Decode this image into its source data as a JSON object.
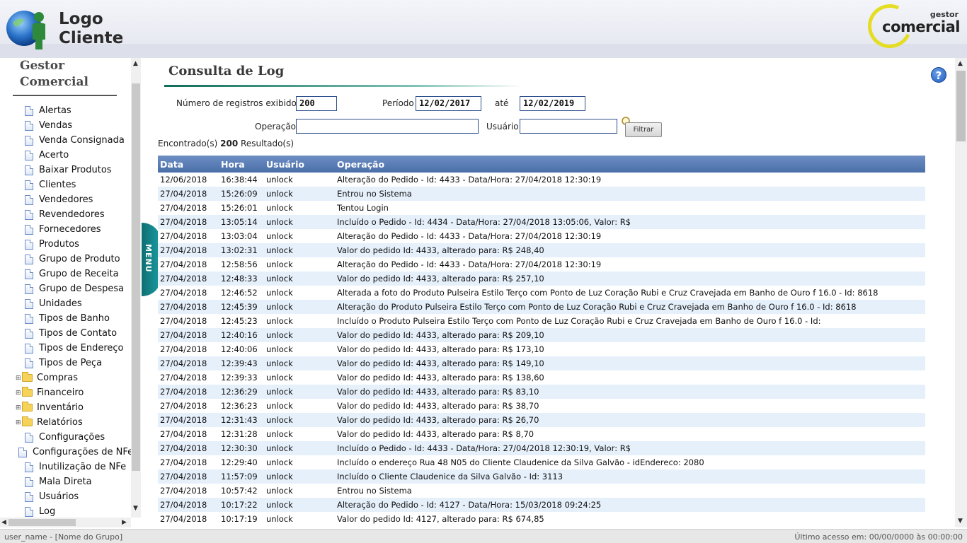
{
  "header": {
    "logo_line1": "Logo",
    "logo_line2": "Cliente",
    "brand_small": "gestor",
    "brand_big": "comercial"
  },
  "sidebar": {
    "title_line1": "Gestor",
    "title_line2": "Comercial",
    "menu_tab": "MENU",
    "items": [
      {
        "label": "Alertas",
        "type": "doc"
      },
      {
        "label": "Vendas",
        "type": "doc"
      },
      {
        "label": "Venda Consignada",
        "type": "doc"
      },
      {
        "label": "Acerto",
        "type": "doc"
      },
      {
        "label": "Baixar Produtos",
        "type": "doc"
      },
      {
        "label": "Clientes",
        "type": "doc"
      },
      {
        "label": "Vendedores",
        "type": "doc"
      },
      {
        "label": "Revendedores",
        "type": "doc"
      },
      {
        "label": "Fornecedores",
        "type": "doc"
      },
      {
        "label": "Produtos",
        "type": "doc"
      },
      {
        "label": "Grupo de Produto",
        "type": "doc"
      },
      {
        "label": "Grupo de Receita",
        "type": "doc"
      },
      {
        "label": "Grupo de Despesa",
        "type": "doc"
      },
      {
        "label": "Unidades",
        "type": "doc"
      },
      {
        "label": "Tipos de Banho",
        "type": "doc"
      },
      {
        "label": "Tipos de Contato",
        "type": "doc"
      },
      {
        "label": "Tipos de Endereço",
        "type": "doc"
      },
      {
        "label": "Tipos de Peça",
        "type": "doc"
      },
      {
        "label": "Compras",
        "type": "folder"
      },
      {
        "label": "Financeiro",
        "type": "folder"
      },
      {
        "label": "Inventário",
        "type": "folder"
      },
      {
        "label": "Relatórios",
        "type": "folder"
      },
      {
        "label": "Configurações",
        "type": "doc"
      },
      {
        "label": "Configurações de NFe",
        "type": "doc"
      },
      {
        "label": "Inutilização de NFe",
        "type": "doc"
      },
      {
        "label": "Mala Direta",
        "type": "doc"
      },
      {
        "label": "Usuários",
        "type": "doc"
      },
      {
        "label": "Log",
        "type": "doc"
      }
    ]
  },
  "main": {
    "title": "Consulta de Log",
    "filters": {
      "num_records_label": "Número de registros exibidos",
      "num_records_value": "200",
      "period_label": "Período",
      "period_start": "12/02/2017",
      "until_label": "até",
      "period_end": "12/02/2019",
      "operation_label": "Operação",
      "operation_value": "",
      "user_label": "Usuário",
      "user_value": "",
      "filter_button": "Filtrar"
    },
    "found_prefix": "Encontrado(s)",
    "found_count": "200",
    "found_suffix": "Resultado(s)",
    "table": {
      "columns": [
        "Data",
        "Hora",
        "Usuário",
        "Operação"
      ],
      "rows": [
        [
          "12/06/2018",
          "16:38:44",
          "unlock",
          "Alteração do Pedido - Id: 4433 - Data/Hora: 27/04/2018 12:30:19"
        ],
        [
          "27/04/2018",
          "15:26:09",
          "unlock",
          "Entrou no Sistema"
        ],
        [
          "27/04/2018",
          "15:26:01",
          "unlock",
          "Tentou Login"
        ],
        [
          "27/04/2018",
          "13:05:14",
          "unlock",
          "Incluído o Pedido - Id: 4434 - Data/Hora: 27/04/2018 13:05:06, Valor: R$"
        ],
        [
          "27/04/2018",
          "13:03:04",
          "unlock",
          "Alteração do Pedido - Id: 4433 - Data/Hora: 27/04/2018 12:30:19"
        ],
        [
          "27/04/2018",
          "13:02:31",
          "unlock",
          "Valor do pedido Id: 4433, alterado para: R$ 248,40"
        ],
        [
          "27/04/2018",
          "12:58:56",
          "unlock",
          "Alteração do Pedido - Id: 4433 - Data/Hora: 27/04/2018 12:30:19"
        ],
        [
          "27/04/2018",
          "12:48:33",
          "unlock",
          "Valor do pedido Id: 4433, alterado para: R$ 257,10"
        ],
        [
          "27/04/2018",
          "12:46:52",
          "unlock",
          "Alterada a foto do Produto Pulseira Estilo Terço com Ponto de Luz Coração Rubi e Cruz Cravejada em Banho de Ouro f 16.0 - Id: 8618"
        ],
        [
          "27/04/2018",
          "12:45:39",
          "unlock",
          "Alteração do Produto Pulseira Estilo Terço com Ponto de Luz Coração Rubi e Cruz Cravejada em Banho de Ouro f 16.0 - Id: 8618"
        ],
        [
          "27/04/2018",
          "12:45:23",
          "unlock",
          "Incluído o Produto Pulseira Estilo Terço com Ponto de Luz Coração Rubi e Cruz Cravejada em Banho de Ouro f 16.0 - Id:"
        ],
        [
          "27/04/2018",
          "12:40:16",
          "unlock",
          "Valor do pedido Id: 4433, alterado para: R$ 209,10"
        ],
        [
          "27/04/2018",
          "12:40:06",
          "unlock",
          "Valor do pedido Id: 4433, alterado para: R$ 173,10"
        ],
        [
          "27/04/2018",
          "12:39:43",
          "unlock",
          "Valor do pedido Id: 4433, alterado para: R$ 149,10"
        ],
        [
          "27/04/2018",
          "12:39:33",
          "unlock",
          "Valor do pedido Id: 4433, alterado para: R$ 138,60"
        ],
        [
          "27/04/2018",
          "12:36:29",
          "unlock",
          "Valor do pedido Id: 4433, alterado para: R$ 83,10"
        ],
        [
          "27/04/2018",
          "12:36:23",
          "unlock",
          "Valor do pedido Id: 4433, alterado para: R$ 38,70"
        ],
        [
          "27/04/2018",
          "12:31:43",
          "unlock",
          "Valor do pedido Id: 4433, alterado para: R$ 26,70"
        ],
        [
          "27/04/2018",
          "12:31:28",
          "unlock",
          "Valor do pedido Id: 4433, alterado para: R$ 8,70"
        ],
        [
          "27/04/2018",
          "12:30:30",
          "unlock",
          "Incluído o Pedido - Id: 4433 - Data/Hora: 27/04/2018 12:30:19, Valor: R$"
        ],
        [
          "27/04/2018",
          "12:29:40",
          "unlock",
          "Incluído o endereço Rua 48 N05 do Cliente Claudenice da Silva Galvão - idEndereco: 2080"
        ],
        [
          "27/04/2018",
          "11:57:09",
          "unlock",
          "Incluído o Cliente Claudenice da Silva Galvão - Id: 3113"
        ],
        [
          "27/04/2018",
          "10:57:42",
          "unlock",
          "Entrou no Sistema"
        ],
        [
          "27/04/2018",
          "10:17:22",
          "unlock",
          "Alteração do Pedido - Id: 4127 - Data/Hora: 15/03/2018 09:24:25"
        ],
        [
          "27/04/2018",
          "10:17:19",
          "unlock",
          "Valor do pedido Id: 4127, alterado para: R$ 674,85"
        ]
      ]
    }
  },
  "footer": {
    "user": "user_name - [Nome do Grupo]",
    "last_access": "Último acesso em: 00/00/0000  às 00:00:00"
  }
}
